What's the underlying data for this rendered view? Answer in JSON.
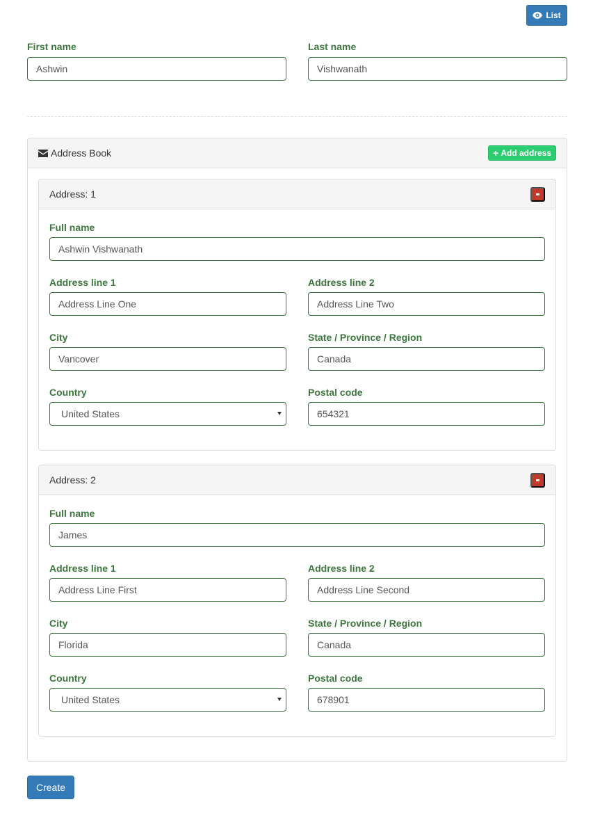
{
  "toolbar": {
    "list_label": "List",
    "list_icon": "eye-icon"
  },
  "person": {
    "first_name_label": "First name",
    "first_name_value": "Ashwin",
    "last_name_label": "Last name",
    "last_name_value": "Vishwanath"
  },
  "address_book": {
    "title": "Address Book",
    "title_icon": "envelope-icon",
    "add_button_label": "Add address",
    "addresses": [
      {
        "title": "Address: 1",
        "full_name_label": "Full name",
        "full_name": "Ashwin Vishwanath",
        "line1_label": "Address line 1",
        "line1": "Address Line One",
        "line2_label": "Address line 2",
        "line2": "Address Line Two",
        "city_label": "City",
        "city": "Vancover",
        "state_label": "State / Province / Region",
        "state": "Canada",
        "country_label": "Country",
        "country": "United States",
        "postal_label": "Postal code",
        "postal": "654321"
      },
      {
        "title": "Address: 2",
        "full_name_label": "Full name",
        "full_name": "James",
        "line1_label": "Address line 1",
        "line1": "Address Line First",
        "line2_label": "Address line 2",
        "line2": "Address Line Second",
        "city_label": "City",
        "city": "Florida",
        "state_label": "State / Province / Region",
        "state": "Canada",
        "country_label": "Country",
        "country": "United States",
        "postal_label": "Postal code",
        "postal": "678901"
      }
    ]
  },
  "footer": {
    "create_label": "Create"
  },
  "colors": {
    "primary": "#337ab7",
    "success_label": "#3c763d",
    "add_button": "#2ecc71",
    "remove_button": "#c0392b"
  }
}
